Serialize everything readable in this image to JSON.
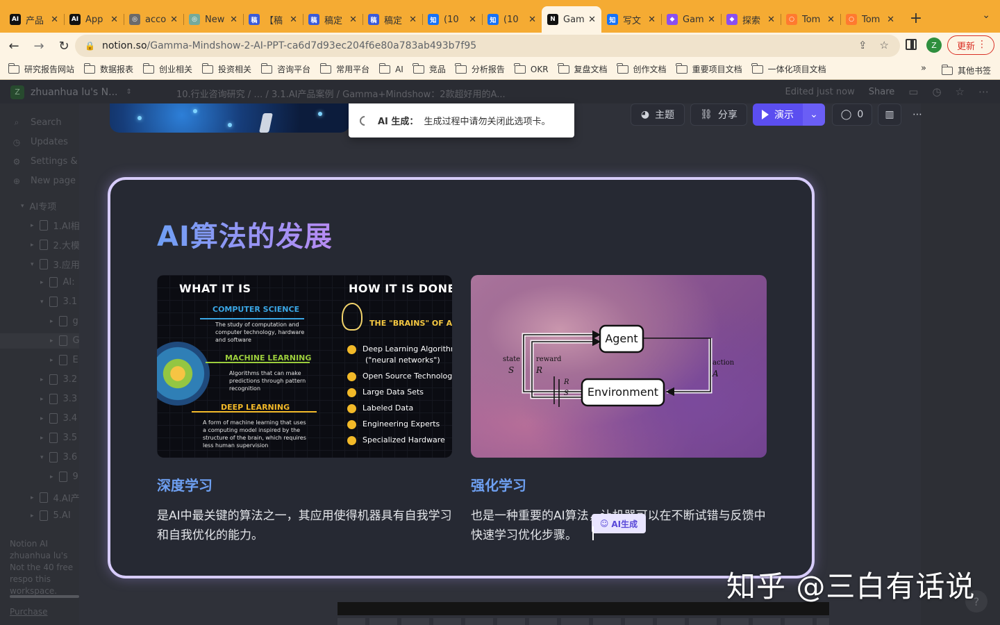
{
  "browser": {
    "tabs": [
      {
        "title": "产品",
        "icon": "AI",
        "color": "#111111"
      },
      {
        "title": "App",
        "icon": "AI",
        "color": "#111111"
      },
      {
        "title": "acco",
        "icon": "◎",
        "color": "#6a6a6a"
      },
      {
        "title": "New",
        "icon": "◎",
        "color": "#74aa9c"
      },
      {
        "title": "【稿",
        "icon": "稿",
        "color": "#3a5bd9"
      },
      {
        "title": "稿定",
        "icon": "稿",
        "color": "#3a5bd9"
      },
      {
        "title": "稿定",
        "icon": "稿",
        "color": "#3a5bd9"
      },
      {
        "title": "(10",
        "icon": "知",
        "color": "#1772f6"
      },
      {
        "title": "(10",
        "icon": "知",
        "color": "#1772f6"
      },
      {
        "title": "Gam",
        "icon": "N",
        "color": "#111111",
        "active": true
      },
      {
        "title": "写文",
        "icon": "知",
        "color": "#1772f6"
      },
      {
        "title": "Gam",
        "icon": "◆",
        "color": "#8a4ff0"
      },
      {
        "title": "探索",
        "icon": "◆",
        "color": "#8a4ff0"
      },
      {
        "title": "Tom",
        "icon": "○",
        "color": "#ff7a2f"
      },
      {
        "title": "Tom",
        "icon": "○",
        "color": "#ff7a2f"
      }
    ],
    "url_host": "notion.so",
    "url_path": "/Gamma-Mindshow-2-AI-PPT-ca6d7d93ec204f6e80a783ab493b7f95",
    "profile_initial": "Z",
    "update_label": "更新",
    "bookmarks": [
      "研究报告网站",
      "数据报表",
      "创业相关",
      "投资相关",
      "咨询平台",
      "常用平台",
      "AI",
      "竞品",
      "分析报告",
      "OKR",
      "复盘文档",
      "创作文档",
      "重要项目文档",
      "一体化项目文档"
    ],
    "bookmarks_more": "»",
    "bookmarks_other": "其他书签"
  },
  "notion": {
    "workspace": "zhuanhua lu's N...",
    "workspace_initial": "Z",
    "breadcrumb": "10.行业咨询研究 / … / 3.1.AI产品案例 / Gamma+Mindshow：2款超好用的A...",
    "edited": "Edited just now",
    "share": "Share",
    "sidebar": {
      "search": "Search",
      "updates": "Updates",
      "settings": "Settings &",
      "new_page": "New page",
      "tree": [
        {
          "label": "AI专项",
          "level": 0,
          "arrow": "▾"
        },
        {
          "label": "1.AI相",
          "level": 1,
          "arrow": "▸"
        },
        {
          "label": "2.大模",
          "level": 1,
          "arrow": "▸"
        },
        {
          "label": "3.应用",
          "level": 1,
          "arrow": "▾"
        },
        {
          "label": "AI:",
          "level": 2,
          "arrow": "▸"
        },
        {
          "label": "3.1",
          "level": 2,
          "arrow": "▾"
        },
        {
          "label": "g",
          "level": 3,
          "arrow": "▸"
        },
        {
          "label": "G",
          "level": 3,
          "arrow": "▸"
        },
        {
          "label": "E",
          "level": 3,
          "arrow": "▸"
        },
        {
          "label": "3.2",
          "level": 2,
          "arrow": "▸"
        },
        {
          "label": "3.3",
          "level": 2,
          "arrow": "▸"
        },
        {
          "label": "3.4",
          "level": 2,
          "arrow": "▸"
        },
        {
          "label": "3.5",
          "level": 2,
          "arrow": "▸"
        },
        {
          "label": "3.6",
          "level": 2,
          "arrow": "▾"
        },
        {
          "label": "9",
          "level": 3,
          "arrow": "▸"
        },
        {
          "label": "4.AI产",
          "level": 1,
          "arrow": "▸"
        },
        {
          "label": "5.AI",
          "level": 1,
          "arrow": "▸"
        }
      ],
      "footer_title": "Notion AI",
      "footer_text": "zhuanhua lu's Not the 40 free respo this workspace.",
      "purchase": "Purchase"
    }
  },
  "gamma": {
    "toast_label": "AI 生成：",
    "toast_text": "生成过程中请勿关闭此选项卡。",
    "toolbar": {
      "theme": "主题",
      "share": "分享",
      "present": "演示",
      "comments": "0"
    },
    "card": {
      "title": "AI算法的发展",
      "left_heading": "深度学习",
      "left_text": "是AI中最关键的算法之一，其应用使得机器具有自我学习和自我优化的能力。",
      "right_heading": "强化学习",
      "right_text": "也是一种重要的AI算法，让机器可以在不断试错与反馈中快速学习优化步骤。",
      "ai_chip": "AI生成"
    },
    "image1": {
      "what_title": "WHAT IT IS",
      "how_title": "HOW IT IS DONE",
      "cs": "COMPUTER SCIENCE",
      "cs_desc": [
        "The study of computation and",
        "computer technology, hardware",
        "and software"
      ],
      "ml": "MACHINE LEARNING",
      "ml_desc": [
        "Algorithms that can make",
        "predictions through pattern",
        "recognition"
      ],
      "dl": "DEEP LEARNING",
      "dl_desc": [
        "A form of machine learning that uses",
        "a computing model inspired by the",
        "structure of the brain, which requires",
        "less human supervision"
      ],
      "brains": "THE \"BRAINS\" OF AI",
      "items": [
        "Deep Learning Algorithms",
        "(\"neural networks\")",
        "Open Source Technology",
        "Large Data Sets",
        "Labeled Data",
        "Engineering Experts",
        "Specialized Hardware"
      ]
    },
    "image2": {
      "agent": "Agent",
      "environment": "Environment",
      "state": "state",
      "state_sym": "S",
      "reward": "reward",
      "reward_sym": "R",
      "action": "action",
      "action_sym": "A",
      "r_next": "R",
      "s_next": "S"
    }
  },
  "watermark": "知乎 @三白有话说"
}
